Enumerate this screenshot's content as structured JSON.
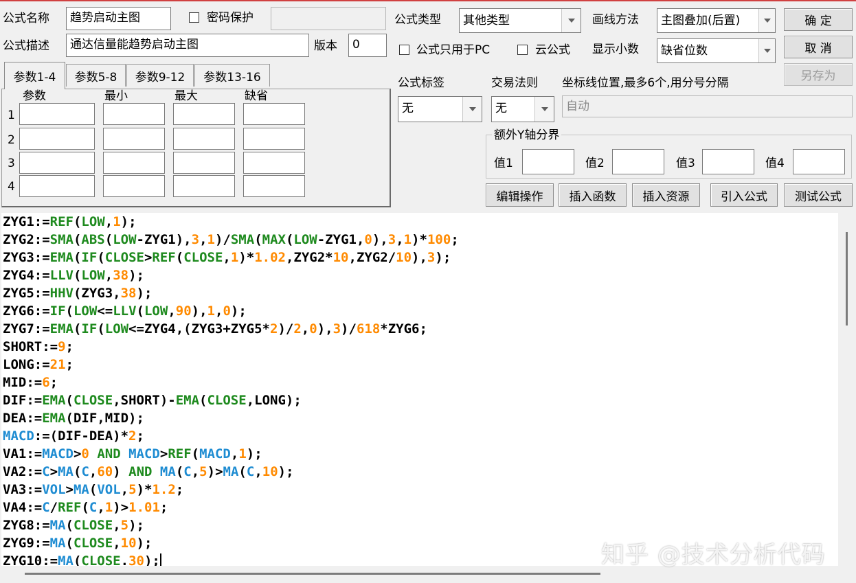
{
  "header": {
    "name_label": "公式名称",
    "name_value": "趋势启动主图",
    "password_label": "密码保护",
    "password_value": "",
    "desc_label": "公式描述",
    "desc_value": "通达信量能趋势启动主图",
    "version_label": "版本",
    "version_value": "0",
    "type_label": "公式类型",
    "type_value": "其他类型",
    "draw_label": "画线方法",
    "draw_value": "主图叠加(后置)",
    "pc_only_label": "公式只用于PC",
    "cloud_label": "云公式",
    "decimals_label": "显示小数",
    "decimals_value": "缺省位数"
  },
  "buttons": {
    "ok": "确 定",
    "cancel": "取 消",
    "save_as": "另存为"
  },
  "tabs": [
    "参数1-4",
    "参数5-8",
    "参数9-12",
    "参数13-16"
  ],
  "params": {
    "columns": [
      "参数",
      "最小",
      "最大",
      "缺省"
    ],
    "rows": [
      "1",
      "2",
      "3",
      "4"
    ]
  },
  "options": {
    "tag_label": "公式标签",
    "tag_value": "无",
    "rule_label": "交易法则",
    "rule_value": "无",
    "coord_label": "坐标线位置,最多6个,用分号分隔",
    "coord_value": "自动",
    "yaxis_label": "额外Y轴分界",
    "v1": "值1",
    "v2": "值2",
    "v3": "值3",
    "v4": "值4"
  },
  "actions": [
    "编辑操作",
    "插入函数",
    "插入资源",
    "引入公式",
    "测试公式"
  ],
  "colors": {
    "function": "#1e8a1e",
    "number": "#ff8a00",
    "reference": "#1e8cd2"
  },
  "code": [
    [
      [
        "p",
        "ZYG1:="
      ],
      [
        "f",
        "REF"
      ],
      [
        "p",
        "("
      ],
      [
        "f",
        "LOW"
      ],
      [
        "p",
        ","
      ],
      [
        "n",
        "1"
      ],
      [
        "p",
        ");"
      ]
    ],
    [
      [
        "p",
        "ZYG2:="
      ],
      [
        "f",
        "SMA"
      ],
      [
        "p",
        "("
      ],
      [
        "f",
        "ABS"
      ],
      [
        "p",
        "("
      ],
      [
        "f",
        "LOW"
      ],
      [
        "p",
        "-ZYG1),"
      ],
      [
        "n",
        "3"
      ],
      [
        "p",
        ","
      ],
      [
        "n",
        "1"
      ],
      [
        "p",
        ")/"
      ],
      [
        "f",
        "SMA"
      ],
      [
        "p",
        "("
      ],
      [
        "f",
        "MAX"
      ],
      [
        "p",
        "("
      ],
      [
        "f",
        "LOW"
      ],
      [
        "p",
        "-ZYG1,"
      ],
      [
        "n",
        "0"
      ],
      [
        "p",
        "),"
      ],
      [
        "n",
        "3"
      ],
      [
        "p",
        ","
      ],
      [
        "n",
        "1"
      ],
      [
        "p",
        ")*"
      ],
      [
        "n",
        "100"
      ],
      [
        "p",
        ";"
      ]
    ],
    [
      [
        "p",
        "ZYG3:="
      ],
      [
        "f",
        "EMA"
      ],
      [
        "p",
        "("
      ],
      [
        "f",
        "IF"
      ],
      [
        "p",
        "("
      ],
      [
        "f",
        "CLOSE"
      ],
      [
        "p",
        ">"
      ],
      [
        "f",
        "REF"
      ],
      [
        "p",
        "("
      ],
      [
        "f",
        "CLOSE"
      ],
      [
        "p",
        ","
      ],
      [
        "n",
        "1"
      ],
      [
        "p",
        ")*"
      ],
      [
        "n",
        "1.02"
      ],
      [
        "p",
        ",ZYG2*"
      ],
      [
        "n",
        "10"
      ],
      [
        "p",
        ",ZYG2/"
      ],
      [
        "n",
        "10"
      ],
      [
        "p",
        "),"
      ],
      [
        "n",
        "3"
      ],
      [
        "p",
        ");"
      ]
    ],
    [
      [
        "p",
        "ZYG4:="
      ],
      [
        "f",
        "LLV"
      ],
      [
        "p",
        "("
      ],
      [
        "f",
        "LOW"
      ],
      [
        "p",
        ","
      ],
      [
        "n",
        "38"
      ],
      [
        "p",
        ");"
      ]
    ],
    [
      [
        "p",
        "ZYG5:="
      ],
      [
        "f",
        "HHV"
      ],
      [
        "p",
        "(ZYG3,"
      ],
      [
        "n",
        "38"
      ],
      [
        "p",
        ");"
      ]
    ],
    [
      [
        "p",
        "ZYG6:="
      ],
      [
        "f",
        "IF"
      ],
      [
        "p",
        "("
      ],
      [
        "f",
        "LOW"
      ],
      [
        "p",
        "<="
      ],
      [
        "f",
        "LLV"
      ],
      [
        "p",
        "("
      ],
      [
        "f",
        "LOW"
      ],
      [
        "p",
        ","
      ],
      [
        "n",
        "90"
      ],
      [
        "p",
        "),"
      ],
      [
        "n",
        "1"
      ],
      [
        "p",
        ","
      ],
      [
        "n",
        "0"
      ],
      [
        "p",
        ");"
      ]
    ],
    [
      [
        "p",
        "ZYG7:="
      ],
      [
        "f",
        "EMA"
      ],
      [
        "p",
        "("
      ],
      [
        "f",
        "IF"
      ],
      [
        "p",
        "("
      ],
      [
        "f",
        "LOW"
      ],
      [
        "p",
        "<=ZYG4,(ZYG3+ZYG5*"
      ],
      [
        "n",
        "2"
      ],
      [
        "p",
        ")/"
      ],
      [
        "n",
        "2"
      ],
      [
        "p",
        ","
      ],
      [
        "n",
        "0"
      ],
      [
        "p",
        "),"
      ],
      [
        "n",
        "3"
      ],
      [
        "p",
        ")/"
      ],
      [
        "n",
        "618"
      ],
      [
        "p",
        "*ZYG6;"
      ]
    ],
    [
      [
        "p",
        "SHORT:="
      ],
      [
        "n",
        "9"
      ],
      [
        "p",
        ";"
      ]
    ],
    [
      [
        "p",
        "LONG:="
      ],
      [
        "n",
        "21"
      ],
      [
        "p",
        ";"
      ]
    ],
    [
      [
        "p",
        "MID:="
      ],
      [
        "n",
        "6"
      ],
      [
        "p",
        ";"
      ]
    ],
    [
      [
        "p",
        "DIF:="
      ],
      [
        "f",
        "EMA"
      ],
      [
        "p",
        "("
      ],
      [
        "f",
        "CLOSE"
      ],
      [
        "p",
        ",SHORT)-"
      ],
      [
        "f",
        "EMA"
      ],
      [
        "p",
        "("
      ],
      [
        "f",
        "CLOSE"
      ],
      [
        "p",
        ",LONG);"
      ]
    ],
    [
      [
        "p",
        "DEA:="
      ],
      [
        "f",
        "EMA"
      ],
      [
        "p",
        "(DIF,MID);"
      ]
    ],
    [
      [
        "r",
        "MACD"
      ],
      [
        "p",
        ":=(DIF-DEA)*"
      ],
      [
        "n",
        "2"
      ],
      [
        "p",
        ";"
      ]
    ],
    [
      [
        "p",
        "VA1:="
      ],
      [
        "r",
        "MACD"
      ],
      [
        "p",
        ">"
      ],
      [
        "n",
        "0"
      ],
      [
        "p",
        " "
      ],
      [
        "k",
        "AND"
      ],
      [
        "p",
        " "
      ],
      [
        "r",
        "MACD"
      ],
      [
        "p",
        ">"
      ],
      [
        "f",
        "REF"
      ],
      [
        "p",
        "("
      ],
      [
        "r",
        "MACD"
      ],
      [
        "p",
        ","
      ],
      [
        "n",
        "1"
      ],
      [
        "p",
        ");"
      ]
    ],
    [
      [
        "p",
        "VA2:="
      ],
      [
        "r",
        "C"
      ],
      [
        "p",
        ">"
      ],
      [
        "r",
        "MA"
      ],
      [
        "p",
        "("
      ],
      [
        "r",
        "C"
      ],
      [
        "p",
        ","
      ],
      [
        "n",
        "60"
      ],
      [
        "p",
        ") "
      ],
      [
        "k",
        "AND"
      ],
      [
        "p",
        " "
      ],
      [
        "r",
        "MA"
      ],
      [
        "p",
        "("
      ],
      [
        "r",
        "C"
      ],
      [
        "p",
        ","
      ],
      [
        "n",
        "5"
      ],
      [
        "p",
        ")>"
      ],
      [
        "r",
        "MA"
      ],
      [
        "p",
        "("
      ],
      [
        "r",
        "C"
      ],
      [
        "p",
        ","
      ],
      [
        "n",
        "10"
      ],
      [
        "p",
        ");"
      ]
    ],
    [
      [
        "p",
        "VA3:="
      ],
      [
        "r",
        "VOL"
      ],
      [
        "p",
        ">"
      ],
      [
        "r",
        "MA"
      ],
      [
        "p",
        "("
      ],
      [
        "r",
        "VOL"
      ],
      [
        "p",
        ","
      ],
      [
        "n",
        "5"
      ],
      [
        "p",
        ")*"
      ],
      [
        "n",
        "1.2"
      ],
      [
        "p",
        ";"
      ]
    ],
    [
      [
        "p",
        "VA4:="
      ],
      [
        "r",
        "C"
      ],
      [
        "p",
        "/"
      ],
      [
        "f",
        "REF"
      ],
      [
        "p",
        "("
      ],
      [
        "r",
        "C"
      ],
      [
        "p",
        ","
      ],
      [
        "n",
        "1"
      ],
      [
        "p",
        ")>"
      ],
      [
        "n",
        "1.01"
      ],
      [
        "p",
        ";"
      ]
    ],
    [
      [
        "p",
        "ZYG8:="
      ],
      [
        "r",
        "MA"
      ],
      [
        "p",
        "("
      ],
      [
        "f",
        "CLOSE"
      ],
      [
        "p",
        ","
      ],
      [
        "n",
        "5"
      ],
      [
        "p",
        ");"
      ]
    ],
    [
      [
        "p",
        "ZYG9:="
      ],
      [
        "r",
        "MA"
      ],
      [
        "p",
        "("
      ],
      [
        "f",
        "CLOSE"
      ],
      [
        "p",
        ","
      ],
      [
        "n",
        "10"
      ],
      [
        "p",
        ");"
      ]
    ],
    [
      [
        "p",
        "ZYG10:="
      ],
      [
        "r",
        "MA"
      ],
      [
        "p",
        "("
      ],
      [
        "f",
        "CLOSE"
      ],
      [
        "p",
        "."
      ],
      [
        "n",
        "30"
      ],
      [
        "p",
        ");"
      ]
    ]
  ],
  "watermark": "知乎 @技术分析代码"
}
